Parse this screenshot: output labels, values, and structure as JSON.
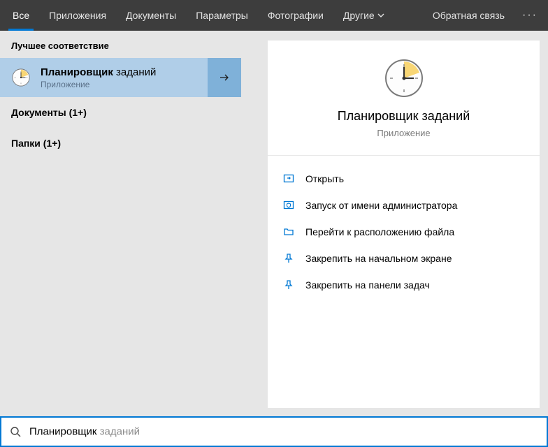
{
  "tabs": {
    "all": "Все",
    "apps": "Приложения",
    "docs": "Документы",
    "settings": "Параметры",
    "photos": "Фотографии",
    "other": "Другие",
    "feedback": "Обратная связь"
  },
  "left": {
    "best_match_header": "Лучшее соответствие",
    "result": {
      "title_bold": "Планировщик",
      "title_rest": " заданий",
      "subtitle": "Приложение"
    },
    "group_docs": "Документы (1+)",
    "group_folders": "Папки (1+)"
  },
  "right": {
    "title": "Планировщик заданий",
    "subtitle": "Приложение",
    "actions": {
      "open": "Открыть",
      "run_admin": "Запуск от имени администратора",
      "file_location": "Перейти к расположению файла",
      "pin_start": "Закрепить на начальном экране",
      "pin_taskbar": "Закрепить на панели задач"
    }
  },
  "search": {
    "typed": "Планировщик",
    "suggestion": " заданий"
  }
}
